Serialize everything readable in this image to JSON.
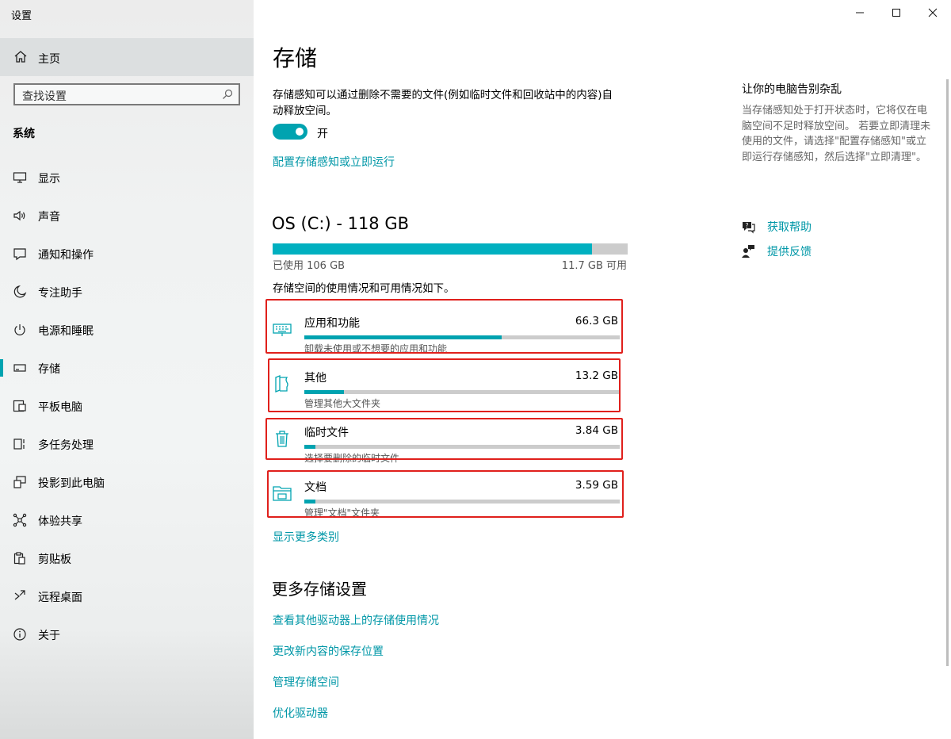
{
  "window": {
    "title": "设置"
  },
  "sidebar": {
    "home_label": "主页",
    "search_placeholder": "查找设置",
    "section_header": "系统",
    "items": [
      {
        "label": "显示",
        "icon": "monitor-icon"
      },
      {
        "label": "声音",
        "icon": "speaker-icon"
      },
      {
        "label": "通知和操作",
        "icon": "notification-icon"
      },
      {
        "label": "专注助手",
        "icon": "moon-icon"
      },
      {
        "label": "电源和睡眠",
        "icon": "power-icon"
      },
      {
        "label": "存储",
        "icon": "storage-icon",
        "active": true
      },
      {
        "label": "平板电脑",
        "icon": "tablet-icon"
      },
      {
        "label": "多任务处理",
        "icon": "multitask-icon"
      },
      {
        "label": "投影到此电脑",
        "icon": "project-icon"
      },
      {
        "label": "体验共享",
        "icon": "share-icon"
      },
      {
        "label": "剪贴板",
        "icon": "clipboard-icon"
      },
      {
        "label": "远程桌面",
        "icon": "remote-icon"
      },
      {
        "label": "关于",
        "icon": "info-icon"
      }
    ]
  },
  "main": {
    "title": "存储",
    "sense_description": "存储感知可以通过删除不需要的文件(例如临时文件和回收站中的内容)自动释放空间。",
    "toggle_state": "开",
    "configure_link": "配置存储感知或立即运行",
    "drive": {
      "title": "OS (C:) - 118 GB",
      "used_label": "已使用 106 GB",
      "free_label": "11.7 GB 可用",
      "used_fraction": 0.9
    },
    "usage_description": "存储空间的使用情况和可用情况如下。",
    "categories": [
      {
        "name": "应用和功能",
        "size": "66.3 GB",
        "sub": "卸载未使用或不想要的应用和功能",
        "fraction": 0.625,
        "icon": "keyboard-icon"
      },
      {
        "name": "其他",
        "size": "13.2 GB",
        "sub": "管理其他大文件夹",
        "fraction": 0.125,
        "icon": "document-folder-icon"
      },
      {
        "name": "临时文件",
        "size": "3.84 GB",
        "sub": "选择要删除的临时文件",
        "fraction": 0.036,
        "icon": "trash-icon"
      },
      {
        "name": "文档",
        "size": "3.59 GB",
        "sub": "管理\"文档\"文件夹",
        "fraction": 0.034,
        "icon": "folder-icon"
      }
    ],
    "show_more_link": "显示更多类别",
    "more_header": "更多存储设置",
    "more_links": [
      "查看其他驱动器上的存储使用情况",
      "更改新内容的保存位置",
      "管理存储空间",
      "优化驱动器"
    ]
  },
  "aside": {
    "title": "让你的电脑告别杂乱",
    "description": "当存储感知处于打开状态时，它将仅在电脑空间不足时释放空间。 若要立即清理未使用的文件，请选择\"配置存储感知\"或立即运行存储感知，然后选择\"立即清理\"。",
    "help_link": "获取帮助",
    "feedback_link": "提供反馈"
  },
  "colors": {
    "accent": "#00a3b0",
    "link": "#0097a7",
    "highlight": "#e0201c"
  }
}
